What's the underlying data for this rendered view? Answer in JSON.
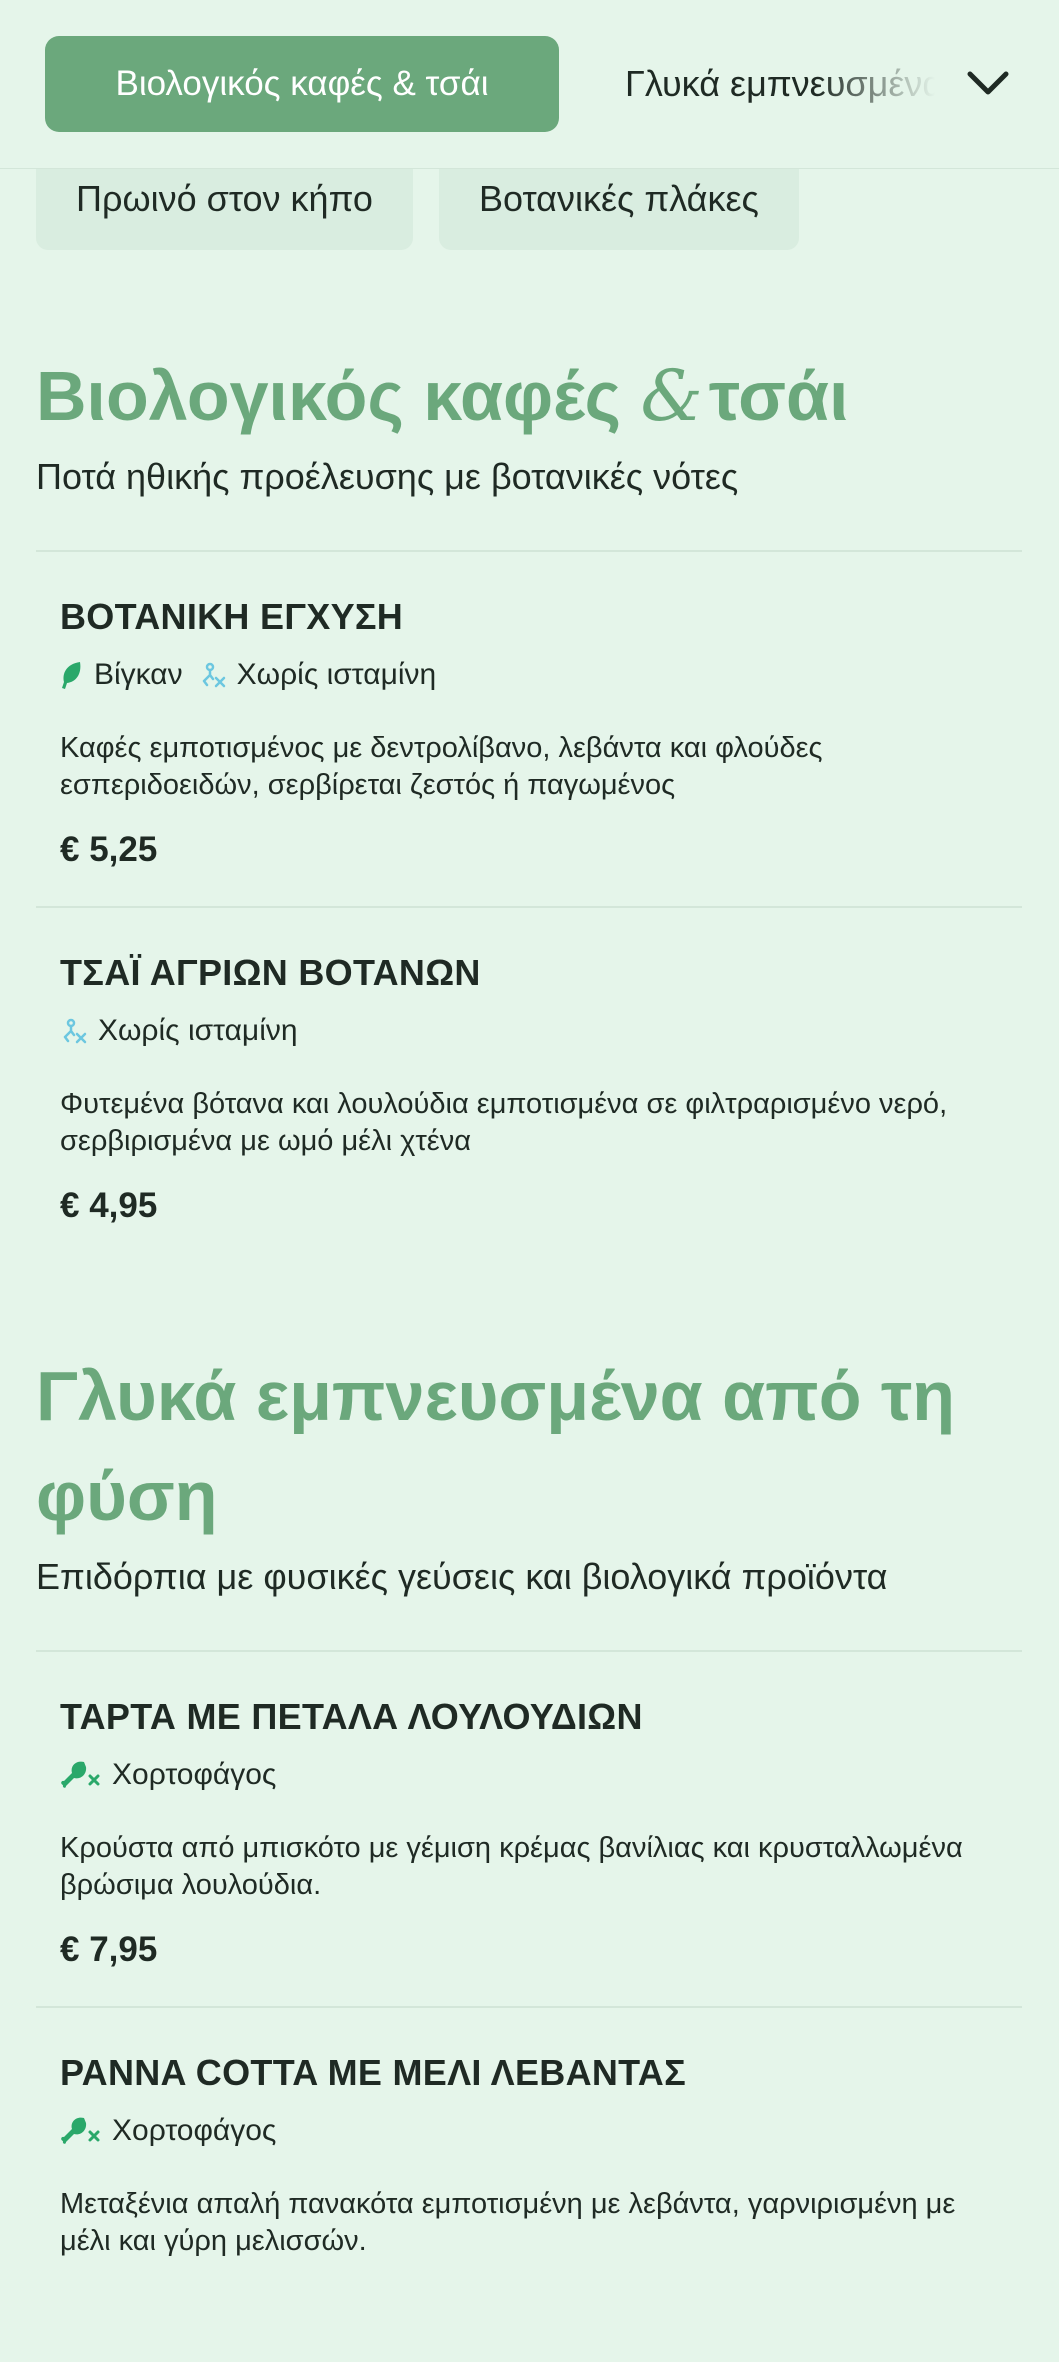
{
  "nav": {
    "active_tab": "Βιολογικός καφές & τσάι",
    "next_tab": "Γλυκά εμπνευσμένα από τη φύση",
    "dropdown_icon": "chevron-down-icon",
    "chips": [
      "Πρωινό στον κήπο",
      "Βοτανικές πλάκες"
    ]
  },
  "colors": {
    "background": "#e5f5ea",
    "accent": "#6ba87c",
    "vegan_icon": "#2aa86a",
    "histamine_icon": "#6cc7e0"
  },
  "sections": [
    {
      "title_part1": "Βιολογικός καφές ",
      "title_amp": "&",
      "title_part2": "τσάι",
      "subtitle": "Ποτά ηθικής προέλευσης με βοτανικές νότες",
      "items": [
        {
          "name": "ΒΟΤΑΝΙΚΗ ΕΓΧΥΣΗ",
          "tags": [
            {
              "icon": "leaf-icon",
              "label": "Βίγκαν"
            },
            {
              "icon": "no-histamine-icon",
              "label": "Χωρίς ισταμίνη"
            }
          ],
          "description": "Καφές εμποτισμένος με δεντρολίβανο, λεβάντα και φλούδες εσπεριδοειδών, σερβίρεται ζεστός ή παγωμένος",
          "price": "€ 5,25"
        },
        {
          "name": "ΤΣΑΪ ΑΓΡΙΩΝ ΒΟΤΑΝΩΝ",
          "tags": [
            {
              "icon": "no-histamine-icon",
              "label": "Χωρίς ισταμίνη"
            }
          ],
          "description": "Φυτεμένα βότανα και λουλούδια εμποτισμένα σε φιλτραρισμένο νερό, σερβιρισμένα με ωμό μέλι χτένα",
          "price": "€ 4,95"
        }
      ]
    },
    {
      "title_part1": "Γλυκά εμπνευσμένα από τη φύση",
      "subtitle": "Επιδόρπια με φυσικές γεύσεις και βιολογικά προϊόντα",
      "items": [
        {
          "name": "ΤΑΡΤΑ ΜΕ ΠΕΤΑΛΑ ΛΟΥΛΟΥΔΙΩΝ",
          "tags": [
            {
              "icon": "vegetarian-no-meat-icon",
              "label": "Χορτοφάγος"
            }
          ],
          "description": "Κρούστα από μπισκότο με γέμιση κρέμας βανίλιας και κρυσταλλωμένα βρώσιμα λουλούδια.",
          "price": "€ 7,95"
        },
        {
          "name": "PANNA COTTA ΜΕ ΜΕΛΙ ΛΕΒΑΝΤΑΣ",
          "tags": [
            {
              "icon": "vegetarian-no-meat-icon",
              "label": "Χορτοφάγος"
            }
          ],
          "description": "Μεταξένια απαλή πανακότα εμποτισμένη με λεβάντα, γαρνιρισμένη με μέλι και γύρη μελισσών.",
          "price": ""
        }
      ]
    }
  ]
}
